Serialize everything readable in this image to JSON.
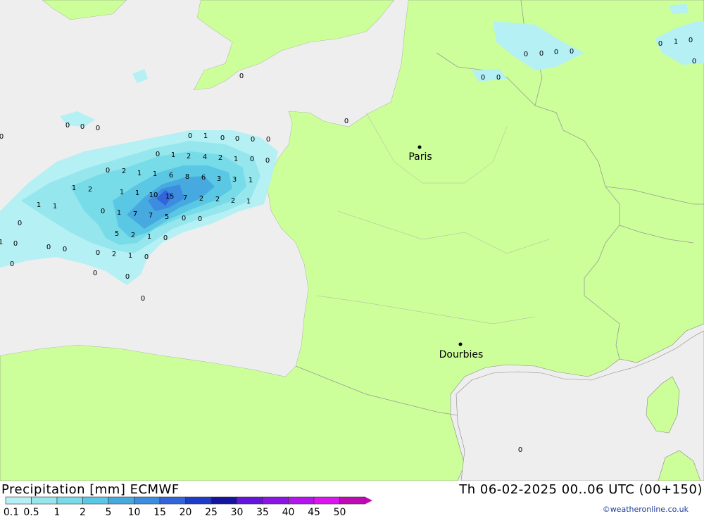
{
  "header": {
    "product_label": "Precipitation [mm] ECMWF",
    "valid_time": "Th 06-02-2025 00..06 UTC (00+150)",
    "credit": "©weatheronline.co.uk"
  },
  "colors": {
    "sea": "#eeeeee",
    "land": "#ccff99",
    "border": "#9a9a9a"
  },
  "cities": [
    {
      "name": "Paris"
    },
    {
      "name": "Dourbies"
    }
  ],
  "legend": {
    "labels": [
      "0.1",
      "0.5",
      "1",
      "2",
      "5",
      "10",
      "15",
      "20",
      "25",
      "30",
      "35",
      "40",
      "45",
      "50"
    ],
    "colors": [
      "#b4f0f4",
      "#96e6ee",
      "#78dce8",
      "#5ac8e4",
      "#46aae0",
      "#3c8ce0",
      "#3264dc",
      "#1e3cc8",
      "#1414a0",
      "#6414dc",
      "#8c14e6",
      "#b414f0",
      "#dc14f0",
      "#c00ab4"
    ]
  },
  "precip_values": [
    "0",
    "0",
    "0",
    "0",
    "1",
    "0",
    "0",
    "0",
    "0",
    "0",
    "1",
    "2",
    "4",
    "2",
    "1",
    "0",
    "0",
    "0",
    "2",
    "1",
    "1",
    "6",
    "8",
    "6",
    "3",
    "3",
    "1",
    "1",
    "2",
    "1",
    "1",
    "10",
    "15",
    "7",
    "2",
    "2",
    "2",
    "1",
    "1",
    "1",
    "0",
    "1",
    "7",
    "7",
    "5",
    "0",
    "0",
    "0",
    "5",
    "2",
    "1",
    "0",
    "1",
    "0",
    "0",
    "0",
    "0",
    "2",
    "1",
    "0",
    "0",
    "0",
    "0",
    "0",
    "0",
    "0",
    "0",
    "0",
    "0",
    "0",
    "0",
    "0",
    "0",
    "0",
    "1",
    "0",
    "0",
    "0",
    "0"
  ]
}
